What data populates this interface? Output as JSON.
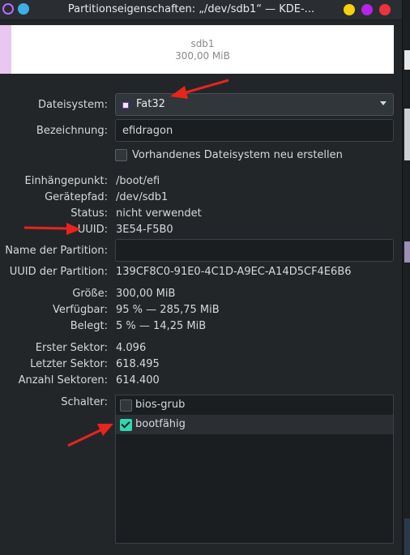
{
  "window": {
    "title": "Partitionseigenschaften: „/dev/sdb1“ — KDE-..."
  },
  "partition_bar": {
    "name": "sdb1",
    "size": "300,00 MiB"
  },
  "filesystem": {
    "label": "Dateisystem:",
    "value": "Fat32"
  },
  "designation": {
    "label": "Bezeichnung:",
    "value": "efidragon"
  },
  "recreate": {
    "label": "Vorhandenes Dateisystem neu erstellen",
    "checked": false
  },
  "info": {
    "mountpoint": {
      "label": "Einhängepunkt:",
      "value": "/boot/efi"
    },
    "devicepath": {
      "label": "Gerätepfad:",
      "value": "/dev/sdb1"
    },
    "status": {
      "label": "Status:",
      "value": "nicht verwendet"
    },
    "uuid": {
      "label": "UUID:",
      "value": "3E54-F5B0"
    }
  },
  "partition_name": {
    "label": "Name der Partition:",
    "value": ""
  },
  "partition_uuid": {
    "label": "UUID der Partition:",
    "value": "139CF8C0-91E0-4C1D-A9EC-A14D5CF4E6B6"
  },
  "sizes": {
    "size": {
      "label": "Größe:",
      "value": "300,00 MiB"
    },
    "available": {
      "label": "Verfügbar:",
      "value": "95 % — 285,75 MiB"
    },
    "used": {
      "label": "Belegt:",
      "value": "5 % — 14,25 MiB"
    }
  },
  "sectors": {
    "first": {
      "label": "Erster Sektor:",
      "value": "4.096"
    },
    "last": {
      "label": "Letzter Sektor:",
      "value": "618.495"
    },
    "count": {
      "label": "Anzahl Sektoren:",
      "value": "614.400"
    }
  },
  "flags": {
    "label": "Schalter:",
    "items": [
      {
        "label": "bios-grub",
        "checked": false
      },
      {
        "label": "bootfähig",
        "checked": true
      }
    ]
  },
  "colors": {
    "accent": "#2fd8b0",
    "annotation_arrow": "#e8241c",
    "background": "#232629"
  }
}
